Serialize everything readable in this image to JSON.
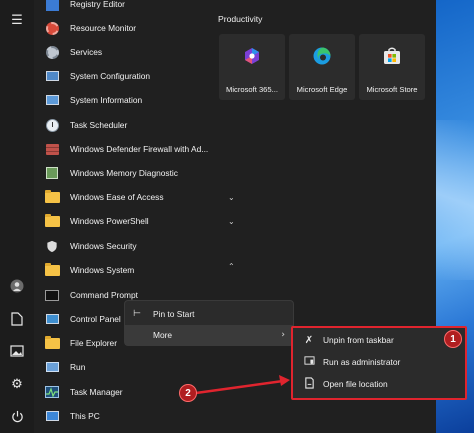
{
  "start_menu": {
    "apps": [
      {
        "label": "Registry Editor",
        "icon": "registry-icon"
      },
      {
        "label": "Resource Monitor",
        "icon": "resource-monitor-icon"
      },
      {
        "label": "Services",
        "icon": "services-gear-icon"
      },
      {
        "label": "System Configuration",
        "icon": "system-configuration-icon"
      },
      {
        "label": "System Information",
        "icon": "system-information-icon"
      },
      {
        "label": "Task Scheduler",
        "icon": "task-scheduler-icon"
      },
      {
        "label": "Windows Defender Firewall with Ad...",
        "icon": "firewall-icon"
      },
      {
        "label": "Windows Memory Diagnostic",
        "icon": "memory-diagnostic-icon"
      }
    ],
    "folders": [
      {
        "label": "Windows Ease of Access",
        "expanded": false
      },
      {
        "label": "Windows PowerShell",
        "expanded": false
      },
      {
        "label": "Windows Security",
        "expanded": null
      },
      {
        "label": "Windows System",
        "expanded": true
      }
    ],
    "system_apps": [
      {
        "label": "Command Prompt",
        "icon": "command-prompt-icon"
      },
      {
        "label": "Control Panel",
        "icon": "control-panel-icon"
      },
      {
        "label": "File Explorer",
        "icon": "file-explorer-icon"
      },
      {
        "label": "Run",
        "icon": "run-icon"
      },
      {
        "label": "Task Manager",
        "icon": "task-manager-icon"
      },
      {
        "label": "This PC",
        "icon": "this-pc-icon"
      }
    ]
  },
  "pinned": {
    "section_label": "Productivity",
    "tiles": [
      {
        "label": "Microsoft 365...",
        "icon": "microsoft-365-icon"
      },
      {
        "label": "Microsoft Edge",
        "icon": "edge-icon"
      },
      {
        "label": "Microsoft Store",
        "icon": "store-icon"
      }
    ]
  },
  "context_menu": {
    "items": [
      {
        "label": "Pin to Start",
        "icon": "pin-icon"
      },
      {
        "label": "More",
        "icon": "chevron-right-icon",
        "highlighted": true
      }
    ]
  },
  "submenu": {
    "items": [
      {
        "label": "Unpin from taskbar",
        "icon": "unpin-icon"
      },
      {
        "label": "Run as administrator",
        "icon": "shield-admin-icon"
      },
      {
        "label": "Open file location",
        "icon": "folder-open-icon"
      }
    ]
  },
  "annotations": {
    "badge_1": "1",
    "badge_2": "2",
    "accent_color": "#e0242e"
  }
}
